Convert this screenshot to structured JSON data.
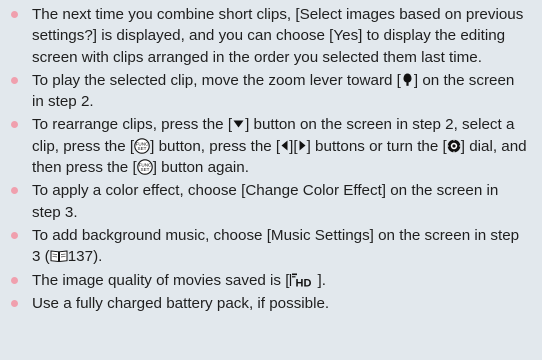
{
  "notes": [
    {
      "parts": [
        "The next time you combine short clips, [Select images based on previous settings?] is displayed, and you can choose [Yes] to display the editing screen with clips arranged in the order you selected them last time."
      ]
    },
    {
      "parts": [
        "To play the selected clip, move the zoom lever toward [",
        "] on the screen in step 2."
      ],
      "icons": [
        "telephoto-icon"
      ]
    },
    {
      "parts": [
        "To rearrange clips, press the [",
        "] button on the screen in step 2, select a clip, press the [",
        "] button, press the [",
        "][",
        "] buttons or turn the [",
        "] dial, and then press the [",
        "] button again."
      ],
      "icons": [
        "down-arrow-icon",
        "func-set-icon",
        "left-arrow-icon",
        "right-arrow-icon",
        "control-dial-icon",
        "func-set-icon"
      ]
    },
    {
      "parts": [
        "To apply a color effect, choose [Change Color Effect] on the screen in step 3."
      ]
    },
    {
      "parts": [
        "To add background music, choose [Music Settings] on the screen in step 3 (",
        "137)."
      ],
      "icons": [
        "page-ref-icon"
      ]
    },
    {
      "parts": [
        "The image quality of movies saved is [",
        "]."
      ],
      "icons": [
        "movie-quality-hd-icon"
      ]
    },
    {
      "parts": [
        "Use a fully charged battery pack, if possible."
      ]
    }
  ],
  "colors": {
    "background": "#e2e8ed",
    "bullet": "#f0a0ae",
    "text": "#1f1f1f"
  }
}
